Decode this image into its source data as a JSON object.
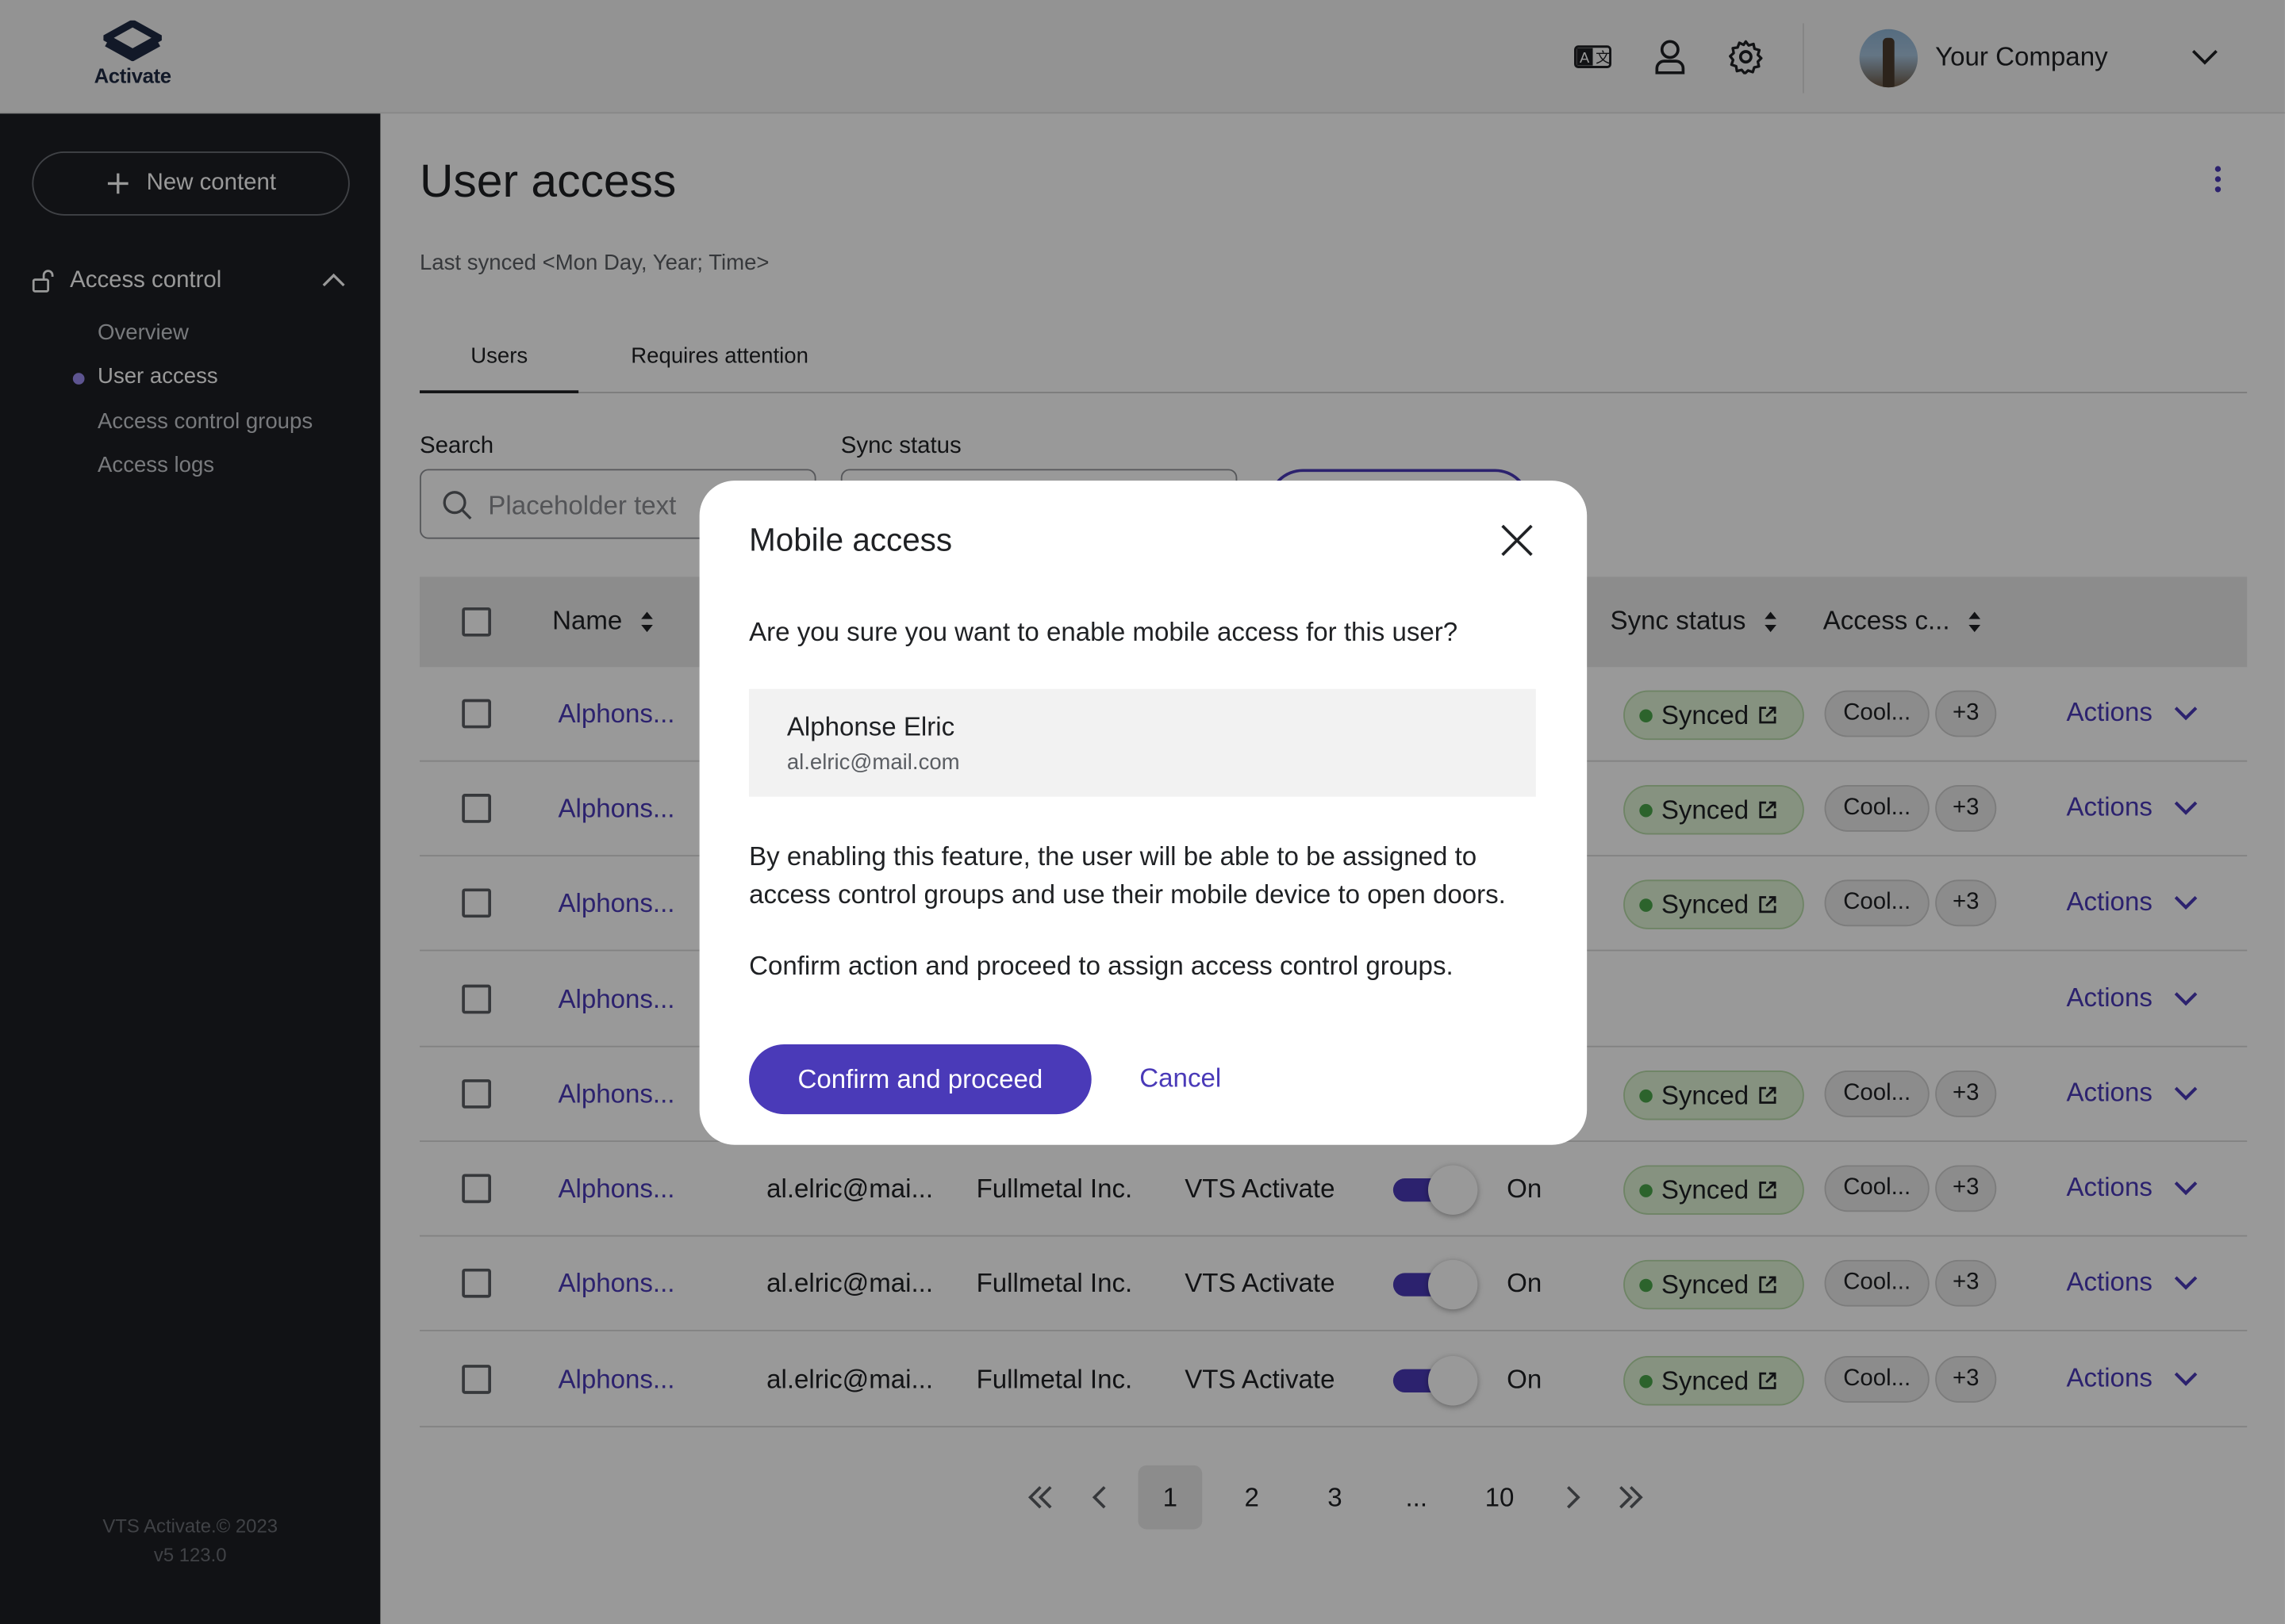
{
  "app": {
    "logo_text": "Activate",
    "brand_color": "#4a3ab8"
  },
  "header": {
    "company_name": "Your Company",
    "icons": [
      "translate-icon",
      "user-icon",
      "gear-icon"
    ]
  },
  "sidebar": {
    "new_content": "New content",
    "section_label": "Access control",
    "items": [
      "Overview",
      "User access",
      "Access control groups",
      "Access logs"
    ],
    "active_item": "User access",
    "footer_line1": "VTS Activate.© 2023",
    "footer_line2": "v5 123.0"
  },
  "main": {
    "title": "User access",
    "last_synced": "Last synced <Mon Day, Year; Time>",
    "tabs": [
      "Users",
      "Requires attention"
    ],
    "search_label": "Search",
    "search_placeholder": "Placeholder text",
    "sync_status_label": "Sync status"
  },
  "table": {
    "headers": {
      "name": "Name",
      "sync_status": "Sync status",
      "access": "Access c..."
    },
    "rows": [
      {
        "name": "Alphons...",
        "email": "",
        "company": "",
        "product": "",
        "toggle": "",
        "sync": "Synced",
        "group": "Cool...",
        "more": "+3",
        "actions": "Actions"
      },
      {
        "name": "Alphons...",
        "email": "",
        "company": "",
        "product": "",
        "toggle": "",
        "sync": "Synced",
        "group": "Cool...",
        "more": "+3",
        "actions": "Actions"
      },
      {
        "name": "Alphons...",
        "email": "",
        "company": "",
        "product": "",
        "toggle": "",
        "sync": "Synced",
        "group": "Cool...",
        "more": "+3",
        "actions": "Actions"
      },
      {
        "name": "Alphons...",
        "email": "",
        "company": "",
        "product": "",
        "toggle": "",
        "sync": "",
        "group": "",
        "more": "",
        "actions": "Actions"
      },
      {
        "name": "Alphons...",
        "email": "",
        "company": "",
        "product": "",
        "toggle": "",
        "sync": "Synced",
        "group": "Cool...",
        "more": "+3",
        "actions": "Actions"
      },
      {
        "name": "Alphons...",
        "email": "al.elric@mai...",
        "company": "Fullmetal Inc.",
        "product": "VTS Activate",
        "toggle": "On",
        "sync": "Synced",
        "group": "Cool...",
        "more": "+3",
        "actions": "Actions"
      },
      {
        "name": "Alphons...",
        "email": "al.elric@mai...",
        "company": "Fullmetal Inc.",
        "product": "VTS Activate",
        "toggle": "On",
        "sync": "Synced",
        "group": "Cool...",
        "more": "+3",
        "actions": "Actions"
      },
      {
        "name": "Alphons...",
        "email": "al.elric@mai...",
        "company": "Fullmetal Inc.",
        "product": "VTS Activate",
        "toggle": "On",
        "sync": "Synced",
        "group": "Cool...",
        "more": "+3",
        "actions": "Actions"
      }
    ]
  },
  "pagination": {
    "pages": [
      "1",
      "2",
      "3",
      "...",
      "10"
    ],
    "current": "1"
  },
  "modal": {
    "title": "Mobile access",
    "question": "Are you sure you want to enable mobile access for this user?",
    "user_name": "Alphonse Elric",
    "user_email": "al.elric@mail.com",
    "body": "By enabling this feature, the user will be able to be assigned to access control groups and use their mobile device to open doors.",
    "body2": "Confirm action and proceed to assign access control groups.",
    "confirm": "Confirm and proceed",
    "cancel": "Cancel"
  }
}
